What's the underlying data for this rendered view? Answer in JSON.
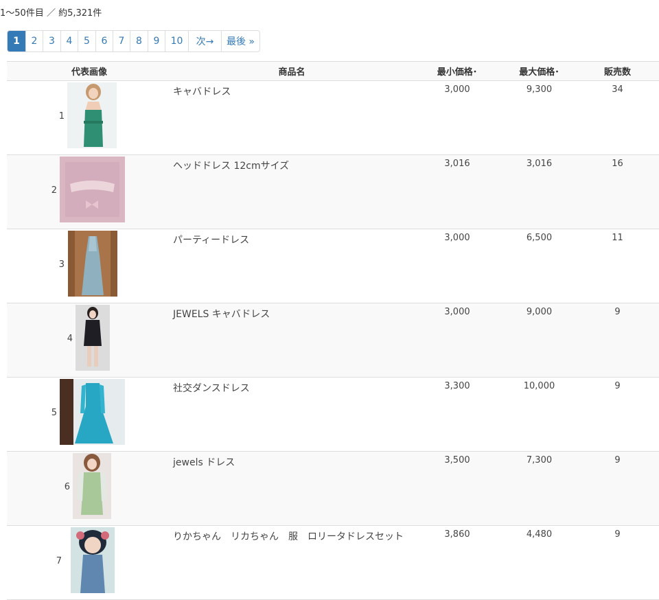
{
  "summary": "1～50件目 ／ 約5,321件",
  "pagination": [
    {
      "label": "1",
      "active": true
    },
    {
      "label": "2"
    },
    {
      "label": "3"
    },
    {
      "label": "4"
    },
    {
      "label": "5"
    },
    {
      "label": "6"
    },
    {
      "label": "7"
    },
    {
      "label": "8"
    },
    {
      "label": "9"
    },
    {
      "label": "10"
    },
    {
      "label": "次→"
    },
    {
      "label": "最後 »"
    }
  ],
  "headers": {
    "image": "代表画像",
    "name": "商品名",
    "min_price": "最小価格･",
    "max_price": "最大価格･",
    "sales": "販売数"
  },
  "rows": [
    {
      "num": "1",
      "name": "キャバドレス",
      "min": "3,000",
      "max": "9,300",
      "sales": "34"
    },
    {
      "num": "2",
      "name": "ヘッドドレス 12cmサイズ",
      "min": "3,016",
      "max": "3,016",
      "sales": "16"
    },
    {
      "num": "3",
      "name": "パーティードレス",
      "min": "3,000",
      "max": "6,500",
      "sales": "11"
    },
    {
      "num": "4",
      "name": "JEWELS キャバドレス",
      "min": "3,000",
      "max": "9,000",
      "sales": "9"
    },
    {
      "num": "5",
      "name": "社交ダンスドレス",
      "min": "3,300",
      "max": "10,000",
      "sales": "9"
    },
    {
      "num": "6",
      "name": "jewels ドレス",
      "min": "3,500",
      "max": "7,300",
      "sales": "9"
    },
    {
      "num": "7",
      "name": "りかちゃん　リカちゃん　服　ロリータドレスセット",
      "min": "3,860",
      "max": "4,480",
      "sales": "9"
    }
  ],
  "colors": {
    "link": "#337ab7",
    "active_bg": "#337ab7",
    "border": "#dddddd",
    "stripe": "#f9f9f9"
  }
}
